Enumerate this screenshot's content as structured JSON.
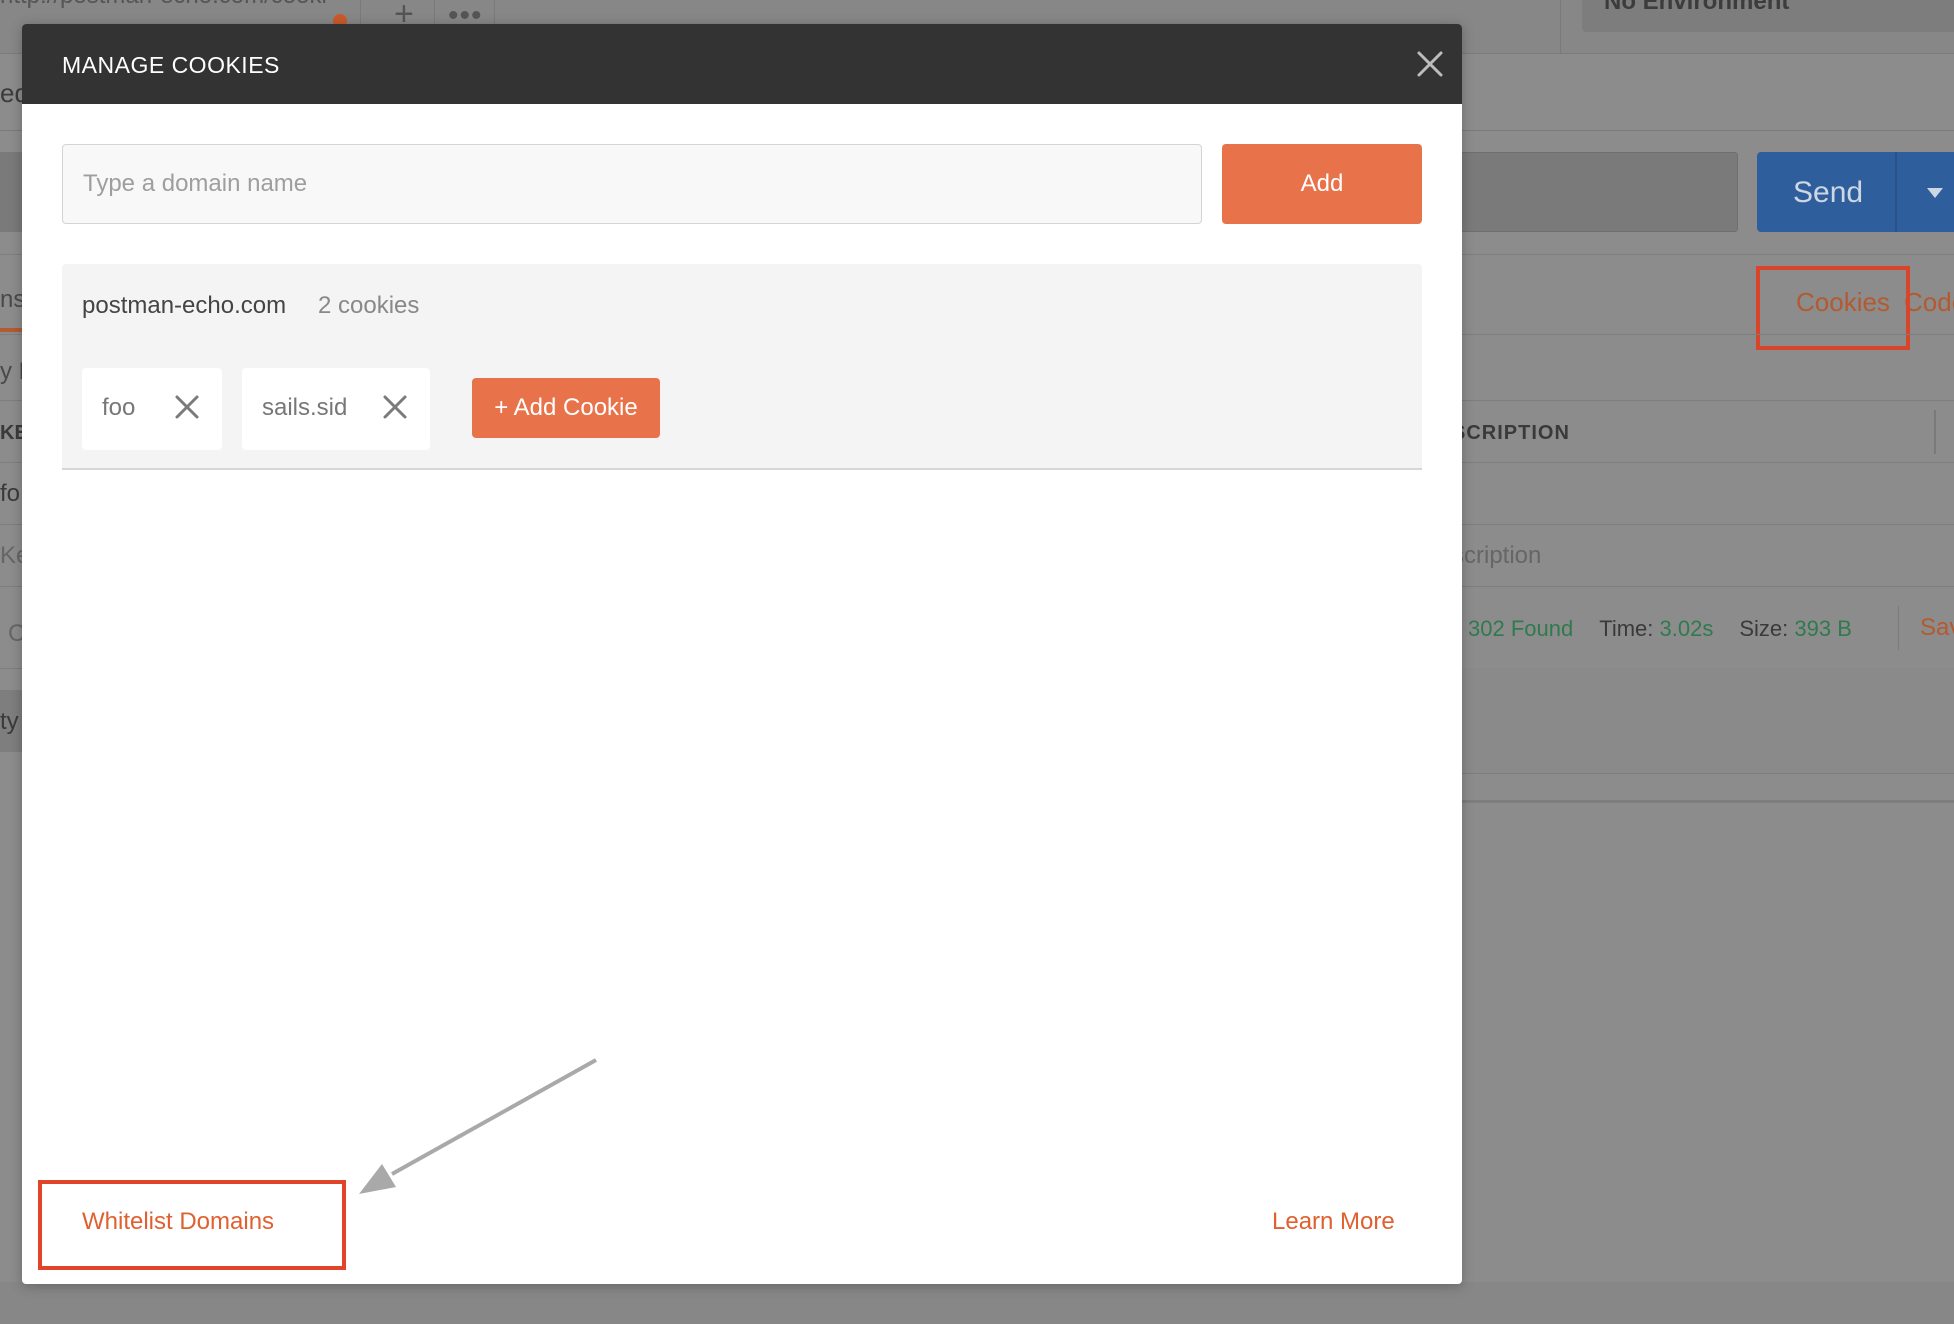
{
  "background": {
    "tab_url": "http://postman-echo.com/cooki",
    "environment": "No Environment",
    "subtitle_fragment": "ed",
    "send_label": "Send",
    "tab_fragment": "ns",
    "params_fragment": "y P",
    "cookies_link": "Cookies",
    "code_link": "Code",
    "key_header_fragment": "KEY",
    "description_header": "SCRIPTION",
    "key_row_fragment": "fo",
    "key_placeholder_fragment": "Ke",
    "description_placeholder": "scription",
    "c_fragment": "C",
    "status": {
      "code": "302 Found",
      "time_label": "Time:",
      "time_value": "3.02s",
      "size_label": "Size:",
      "size_value": "393 B"
    },
    "save_fragment": "Sav",
    "type_fragment": "ty"
  },
  "modal": {
    "title": "MANAGE COOKIES",
    "close_icon": "close-icon",
    "domain_input": {
      "placeholder": "Type a domain name",
      "value": ""
    },
    "add_label": "Add",
    "domains": [
      {
        "name": "postman-echo.com",
        "count_label": "2 cookies",
        "cookies": [
          "foo",
          "sails.sid"
        ],
        "add_cookie_label": "+ Add Cookie"
      }
    ],
    "whitelist_label": "Whitelist Domains",
    "learn_more_label": "Learn More"
  },
  "colors": {
    "accent": "#e8734a",
    "header": "#333333",
    "highlight_box": "#e0452a",
    "link": "#e0602f",
    "send_button": "#2f5e9c",
    "status_green": "#2f7a4e"
  }
}
